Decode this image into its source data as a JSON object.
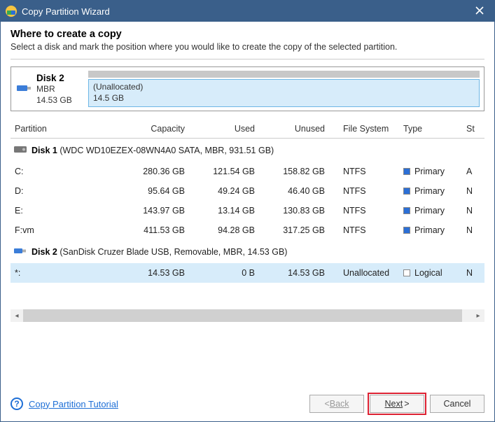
{
  "titlebar": {
    "title": "Copy Partition Wizard"
  },
  "heading": "Where to create a copy",
  "subheading": "Select a disk and mark the position where you would like to create the copy of the selected partition.",
  "preview": {
    "name": "Disk 2",
    "scheme": "MBR",
    "size": "14.53 GB",
    "seg_label": "(Unallocated)",
    "seg_size": "14.5 GB"
  },
  "columns": {
    "partition": "Partition",
    "capacity": "Capacity",
    "used": "Used",
    "unused": "Unused",
    "filesystem": "File System",
    "type": "Type",
    "status": "St"
  },
  "disk1": {
    "label": "Disk 1",
    "detail": "(WDC WD10EZEX-08WN4A0 SATA, MBR, 931.51 GB)",
    "rows": [
      {
        "part": "C:",
        "cap": "280.36 GB",
        "used": "121.54 GB",
        "unus": "158.82 GB",
        "fs": "NTFS",
        "type": "Primary",
        "sw": "primary",
        "st": "A"
      },
      {
        "part": "D:",
        "cap": "95.64 GB",
        "used": "49.24 GB",
        "unus": "46.40 GB",
        "fs": "NTFS",
        "type": "Primary",
        "sw": "primary",
        "st": "N"
      },
      {
        "part": "E:",
        "cap": "143.97 GB",
        "used": "13.14 GB",
        "unus": "130.83 GB",
        "fs": "NTFS",
        "type": "Primary",
        "sw": "primary",
        "st": "N"
      },
      {
        "part": "F:vm",
        "cap": "411.53 GB",
        "used": "94.28 GB",
        "unus": "317.25 GB",
        "fs": "NTFS",
        "type": "Primary",
        "sw": "primary",
        "st": "N"
      }
    ]
  },
  "disk2": {
    "label": "Disk 2",
    "detail": "(SanDisk Cruzer Blade USB, Removable, MBR, 14.53 GB)",
    "rows": [
      {
        "part": "*:",
        "cap": "14.53 GB",
        "used": "0 B",
        "unus": "14.53 GB",
        "fs": "Unallocated",
        "type": "Logical",
        "sw": "logical",
        "st": "N",
        "selected": true
      }
    ]
  },
  "footer": {
    "help_text": "Copy Partition Tutorial",
    "back": "Back",
    "next": "Next",
    "cancel": "Cancel"
  }
}
